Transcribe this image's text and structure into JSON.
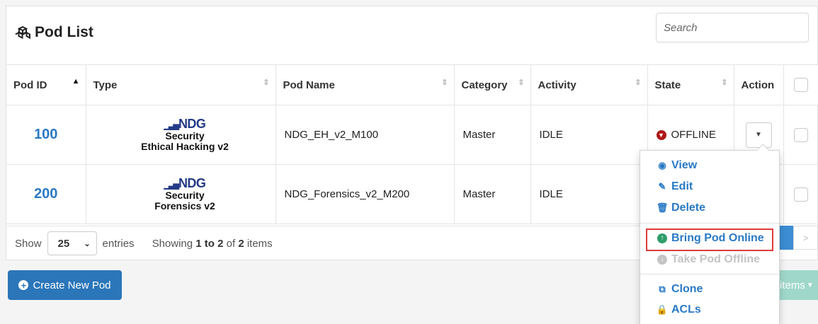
{
  "header": {
    "title": "Pod List",
    "title_icon": "cubes-icon",
    "search_placeholder": "Search"
  },
  "table": {
    "columns": [
      "Pod ID",
      "Type",
      "Pod Name",
      "Category",
      "Activity",
      "State",
      "Action"
    ],
    "rows": [
      {
        "pod_id": "100",
        "type_logo": "NDG",
        "type_line1": "Security",
        "type_line2": "Ethical Hacking v2",
        "pod_name": "NDG_EH_v2_M100",
        "category": "Master",
        "activity": "IDLE",
        "state": "OFFLINE"
      },
      {
        "pod_id": "200",
        "type_logo": "NDG",
        "type_line1": "Security",
        "type_line2": "Forensics v2",
        "pod_name": "NDG_Forensics_v2_M200",
        "category": "Master",
        "activity": "IDLE",
        "state": ""
      }
    ]
  },
  "footer": {
    "show_label": "Show",
    "page_size": "25",
    "entries_label": "entries",
    "showing_prefix": "Showing",
    "showing_range": "1 to 2",
    "showing_of": "of",
    "showing_total": "2",
    "showing_suffix": "items",
    "next_label": ">"
  },
  "create_button": "Create New Pod",
  "items_button": "items",
  "action_menu": {
    "view": "View",
    "edit": "Edit",
    "delete": "Delete",
    "bring_online": "Bring Pod Online",
    "take_offline": "Take Pod Offline",
    "clone": "Clone",
    "acls": "ACLs"
  },
  "colors": {
    "link": "#2979c5",
    "primary_button": "#2b76b9",
    "offline": "#b01818",
    "highlight": "#e03a3a"
  }
}
